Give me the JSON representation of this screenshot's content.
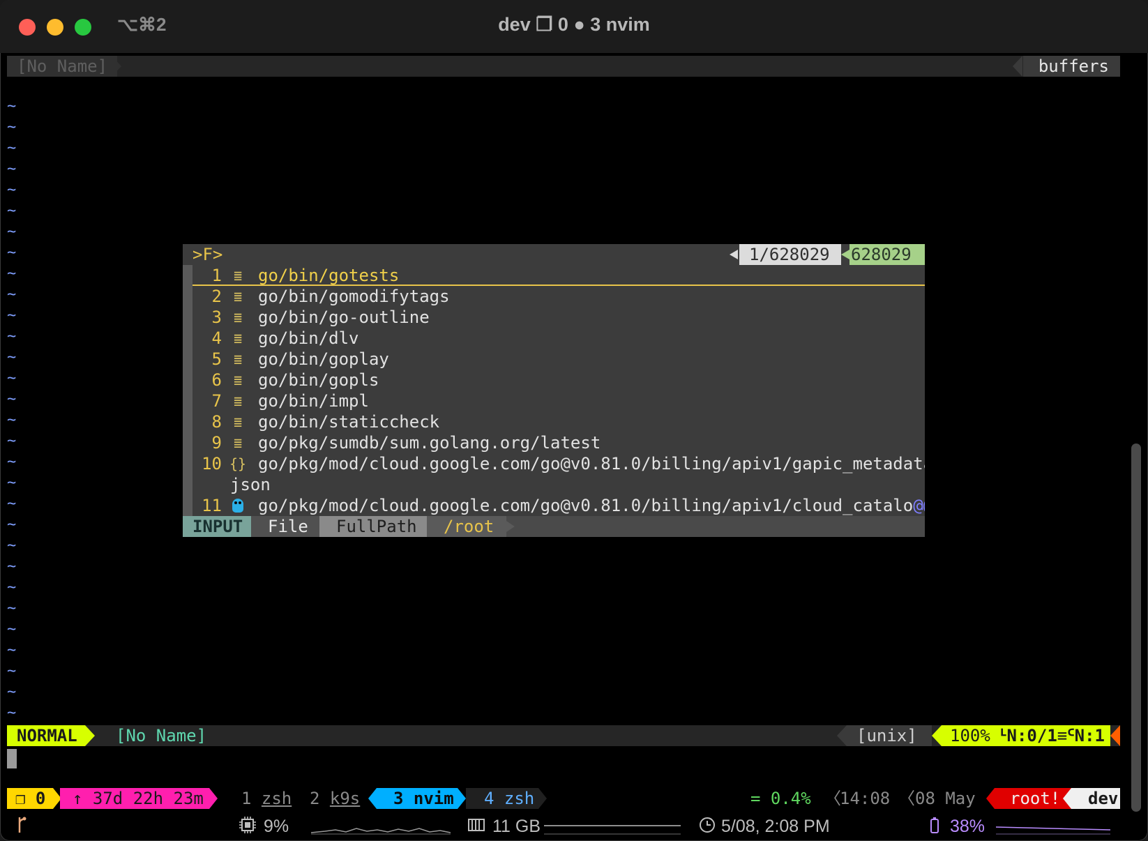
{
  "window": {
    "shortcut": "⌥⌘2",
    "title": "dev ❐ 0 ● 3 nvim"
  },
  "tabline": {
    "buffer_name": "[No Name]",
    "right_label": "buffers"
  },
  "editor": {
    "empty_line_marker": "~",
    "empty_line_count": 30
  },
  "finder": {
    "prompt": ">F>",
    "position": "1/628029",
    "total": "628029",
    "selected_index": 0,
    "results": [
      {
        "num": "1",
        "icon": "file-lines-icon",
        "path": "go/bin/gotests"
      },
      {
        "num": "2",
        "icon": "file-lines-icon",
        "path": "go/bin/gomodifytags"
      },
      {
        "num": "3",
        "icon": "file-lines-icon",
        "path": "go/bin/go-outline"
      },
      {
        "num": "4",
        "icon": "file-lines-icon",
        "path": "go/bin/dlv"
      },
      {
        "num": "5",
        "icon": "file-lines-icon",
        "path": "go/bin/goplay"
      },
      {
        "num": "6",
        "icon": "file-lines-icon",
        "path": "go/bin/gopls"
      },
      {
        "num": "7",
        "icon": "file-lines-icon",
        "path": "go/bin/impl"
      },
      {
        "num": "8",
        "icon": "file-lines-icon",
        "path": "go/bin/staticcheck"
      },
      {
        "num": "9",
        "icon": "file-lines-icon",
        "path": "go/pkg/sumdb/sum.golang.org/latest"
      },
      {
        "num": "10",
        "icon": "json-braces-icon",
        "path": "go/pkg/mod/cloud.google.com/go@v0.81.0/billing/apiv1/gapic_metadata.",
        "wrap": "json"
      },
      {
        "num": "11",
        "icon": "gopher-icon",
        "path": "go/pkg/mod/cloud.google.com/go@v0.81.0/billing/apiv1/cloud_catalo",
        "truncated": "@@@"
      }
    ],
    "status": {
      "mode": "INPUT",
      "provider": "File",
      "matcher": "FullPath",
      "cwd": "/root"
    }
  },
  "statusline": {
    "mode": "NORMAL",
    "filename": "[No Name]",
    "fileformat": "[unix]",
    "percent": "100%",
    "line_icon": "ᒻN",
    "line_info": ":0/1",
    "col_sep": "≡",
    "col_icon": "ᑦN",
    "col_info": ":1"
  },
  "tmux": {
    "session": "❐ 0",
    "uptime": "↑ 37d 22h 23m",
    "windows": [
      {
        "index": "1",
        "name": "zsh",
        "active": false
      },
      {
        "index": "2",
        "name": "k9s",
        "active": false
      },
      {
        "index": "3",
        "name": "nvim",
        "active": true
      },
      {
        "index": "4",
        "name": "zsh",
        "active": false
      }
    ],
    "load": "= 0.4%",
    "time": "14:08",
    "date": "08 May",
    "user": "root!",
    "host": "dev"
  },
  "system": {
    "git_icon": "git-branch-icon",
    "cpu": "9%",
    "memory": "11 GB",
    "datetime": "5/08, 2:08 PM",
    "battery": "38%"
  },
  "colors": {
    "accent_yellow": "#d7ff00",
    "selection_gold": "#e8c44a",
    "tmux_pink": "#ff1fae",
    "tmux_blue": "#00afff",
    "root_red": "#e00000",
    "tilde_blue": "#7f9fff"
  }
}
